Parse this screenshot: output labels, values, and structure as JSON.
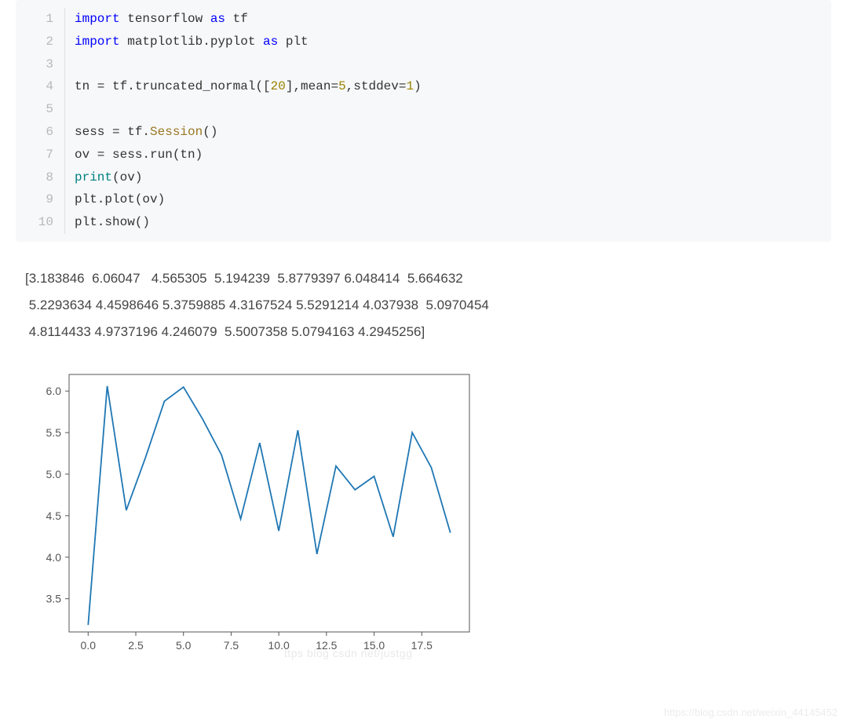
{
  "code": {
    "lines": [
      {
        "n": "1",
        "tokens": [
          {
            "c": "kw",
            "t": "import"
          },
          {
            "c": "",
            "t": " tensorflow "
          },
          {
            "c": "as",
            "t": "as"
          },
          {
            "c": "",
            "t": " tf"
          }
        ]
      },
      {
        "n": "2",
        "tokens": [
          {
            "c": "kw",
            "t": "import"
          },
          {
            "c": "",
            "t": " matplotlib.pyplot "
          },
          {
            "c": "as",
            "t": "as"
          },
          {
            "c": "",
            "t": " plt"
          }
        ]
      },
      {
        "n": "3",
        "tokens": [
          {
            "c": "",
            "t": ""
          }
        ]
      },
      {
        "n": "4",
        "tokens": [
          {
            "c": "",
            "t": "tn = tf.truncated_normal(["
          },
          {
            "c": "num",
            "t": "20"
          },
          {
            "c": "",
            "t": "],mean="
          },
          {
            "c": "num",
            "t": "5"
          },
          {
            "c": "",
            "t": ",stddev="
          },
          {
            "c": "num",
            "t": "1"
          },
          {
            "c": "",
            "t": ")"
          }
        ]
      },
      {
        "n": "5",
        "tokens": [
          {
            "c": "",
            "t": ""
          }
        ]
      },
      {
        "n": "6",
        "tokens": [
          {
            "c": "",
            "t": "sess = tf."
          },
          {
            "c": "fn",
            "t": "Session"
          },
          {
            "c": "",
            "t": "()"
          }
        ]
      },
      {
        "n": "7",
        "tokens": [
          {
            "c": "",
            "t": "ov = sess.run(tn)"
          }
        ]
      },
      {
        "n": "8",
        "tokens": [
          {
            "c": "bi",
            "t": "print"
          },
          {
            "c": "",
            "t": "(ov)"
          }
        ]
      },
      {
        "n": "9",
        "tokens": [
          {
            "c": "",
            "t": "plt.plot(ov)"
          }
        ]
      },
      {
        "n": "10",
        "tokens": [
          {
            "c": "",
            "t": "plt.show()"
          }
        ]
      }
    ]
  },
  "output": "[3.183846  6.06047   4.565305  5.194239  5.8779397 6.048414  5.664632\n 5.2293634 4.4598646 5.3759885 4.3167524 5.5291214 4.037938  5.0970454\n 4.8114433 4.9737196 4.246079  5.5007358 5.0794163 4.2945256]",
  "chart_data": {
    "type": "line",
    "x": [
      0,
      1,
      2,
      3,
      4,
      5,
      6,
      7,
      8,
      9,
      10,
      11,
      12,
      13,
      14,
      15,
      16,
      17,
      18,
      19
    ],
    "values": [
      3.183846,
      6.06047,
      4.565305,
      5.194239,
      5.8779397,
      6.048414,
      5.664632,
      5.2293634,
      4.4598646,
      5.3759885,
      4.3167524,
      5.5291214,
      4.037938,
      5.0970454,
      4.8114433,
      4.9737196,
      4.246079,
      5.5007358,
      5.0794163,
      4.2945256
    ],
    "xticks": [
      0.0,
      2.5,
      5.0,
      7.5,
      10.0,
      12.5,
      15.0,
      17.5
    ],
    "yticks": [
      3.5,
      4.0,
      4.5,
      5.0,
      5.5,
      6.0
    ],
    "xlim": [
      -1,
      20
    ],
    "ylim": [
      3.1,
      6.2
    ],
    "line_color": "#1f77b4"
  },
  "watermark": {
    "inline": "ttps blog csdn net/justgg",
    "corner": "https://blog.csdn.net/weixin_44145452"
  }
}
